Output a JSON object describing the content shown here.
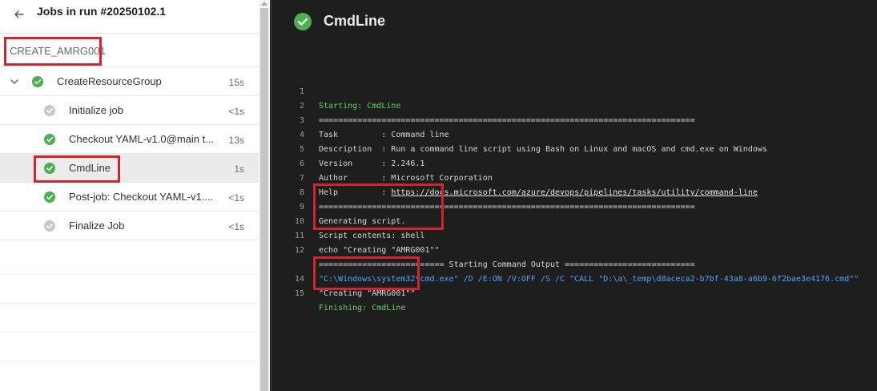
{
  "sidebar": {
    "header_title": "Jobs in run #20250102.1",
    "job_name": "CREATE_AMRG001",
    "job": {
      "label": "CreateResourceGroup",
      "duration": "15s",
      "status": "succeeded"
    },
    "steps": [
      {
        "label": "Initialize job",
        "duration": "<1s",
        "status": "skipped"
      },
      {
        "label": "Checkout YAML-v1.0@main t...",
        "duration": "13s",
        "status": "succeeded"
      },
      {
        "label": "CmdLine",
        "duration": "1s",
        "status": "succeeded",
        "selected": true
      },
      {
        "label": "Post-job: Checkout YAML-v1....",
        "duration": "<1s",
        "status": "succeeded"
      },
      {
        "label": "Finalize Job",
        "duration": "<1s",
        "status": "skipped"
      }
    ]
  },
  "log_panel": {
    "title": "CmdLine",
    "lines": [
      {
        "n": "1",
        "text": "Starting: CmdLine",
        "style": "green"
      },
      {
        "n": "2",
        "text": "==============================================================================",
        "style": "normal"
      },
      {
        "n": "3",
        "text": "Task         : Command line",
        "style": "normal"
      },
      {
        "n": "4",
        "text": "Description  : Run a command line script using Bash on Linux and macOS and cmd.exe on Windows",
        "style": "normal"
      },
      {
        "n": "5",
        "text": "Version      : 2.246.1",
        "style": "normal"
      },
      {
        "n": "6",
        "text": "Author       : Microsoft Corporation",
        "style": "normal"
      },
      {
        "n": "7",
        "text_prefix": "Help         : ",
        "link": "https://docs.microsoft.com/azure/devops/pipelines/tasks/utility/command-line",
        "style": "normal"
      },
      {
        "n": "8",
        "text": "==============================================================================",
        "style": "normal"
      },
      {
        "n": "9",
        "text": "Generating script.",
        "style": "normal"
      },
      {
        "n": "10",
        "text": "Script contents: shell",
        "style": "normal"
      },
      {
        "n": "11",
        "text": "echo \"Creating \"AMRG001\"\"",
        "style": "normal"
      },
      {
        "n": "12",
        "text": "========================== Starting Command Output ===========================",
        "style": "normal"
      },
      {
        "n": "",
        "text": "\"C:\\Windows\\system32\\cmd.exe\" /D /E:ON /V:OFF /S /C \"CALL \"D:\\a\\_temp\\d8aceca2-b7bf-43a8-a6b9-6f2bae3e4176.cmd\"\"",
        "style": "blue"
      },
      {
        "n": "14",
        "text": "\"Creating \"AMRG001\"\"",
        "style": "normal"
      },
      {
        "n": "15",
        "text": "Finishing: CmdLine",
        "style": "green"
      }
    ]
  },
  "icons": {
    "back": "arrow-left-icon",
    "expand": "chevron-down-icon",
    "succeeded": "check-circle-icon",
    "skipped": "skipped-circle-icon"
  },
  "colors": {
    "success": "#4caf50",
    "skipped": "#c8c8c8",
    "highlight": "#d3242e",
    "log_green": "#5fd35f",
    "log_blue": "#4ea3ff"
  }
}
